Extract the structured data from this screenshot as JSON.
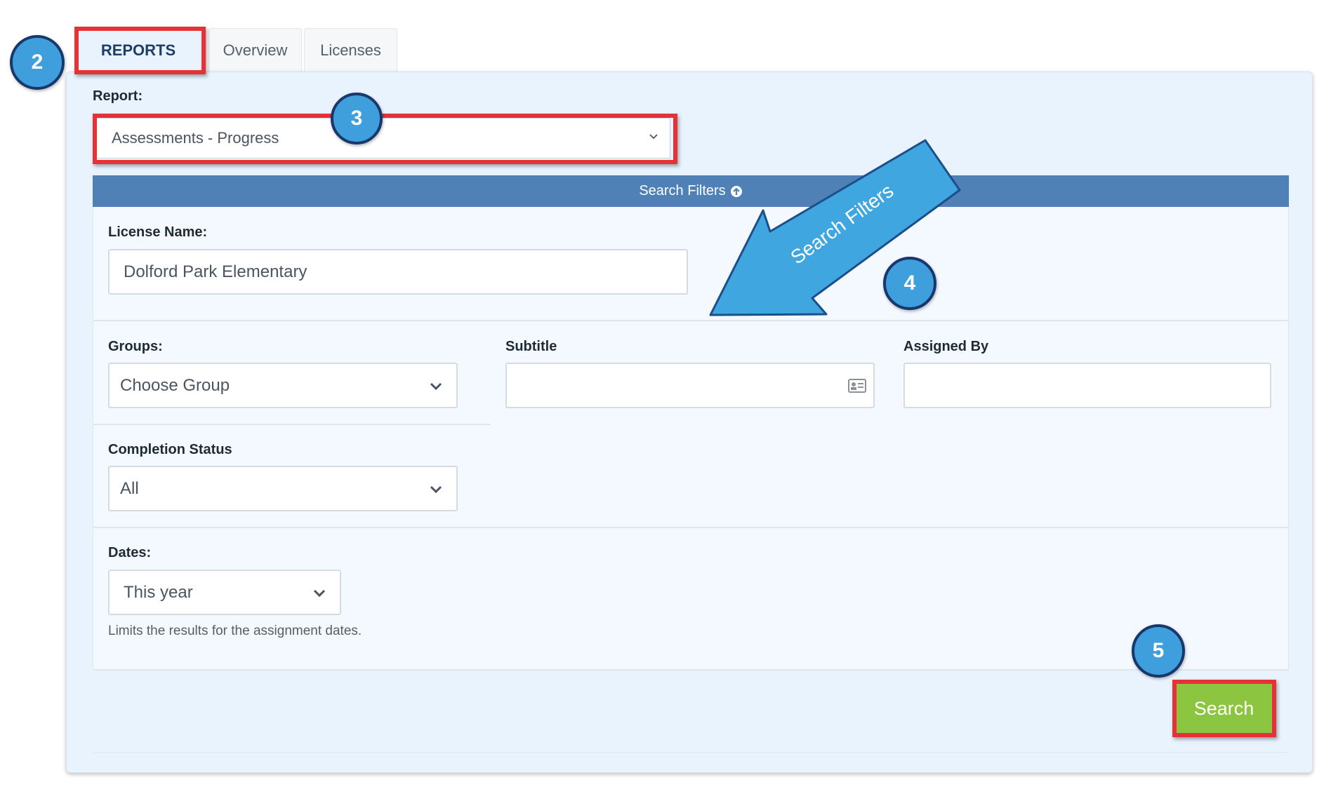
{
  "tabs": [
    {
      "label": "REPORTS",
      "active": true
    },
    {
      "label": "Overview",
      "active": false
    },
    {
      "label": "Licenses",
      "active": false
    }
  ],
  "report": {
    "label": "Report:",
    "selected": "Assessments - Progress"
  },
  "filters": {
    "header": "Search Filters",
    "license": {
      "label": "License Name:",
      "value": "Dolford Park Elementary"
    },
    "groups": {
      "label": "Groups:",
      "value": "Choose Group"
    },
    "subtitle": {
      "label": "Subtitle",
      "value": ""
    },
    "assigned_by": {
      "label": "Assigned By",
      "value": ""
    },
    "completion": {
      "label": "Completion Status",
      "value": "All"
    },
    "dates": {
      "label": "Dates:",
      "value": "This year",
      "help": "Limits the results for the assignment dates."
    }
  },
  "search_button": "Search",
  "annotations": {
    "badges": [
      "2",
      "3",
      "4",
      "5"
    ],
    "arrow_text": "Search Filters",
    "highlight_color": "#e53238",
    "badge_color": "#3f9fdc"
  },
  "colors": {
    "filters_bar": "#4f81b7",
    "search_button": "#8cc640",
    "panel_bg": "#e9f3fd"
  }
}
